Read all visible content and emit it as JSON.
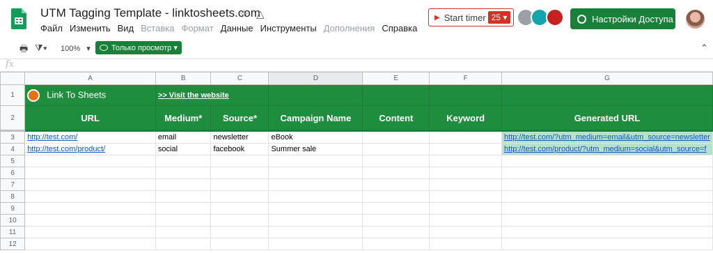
{
  "doc": {
    "title": "UTM Tagging Template - linktosheets.com",
    "menu": [
      {
        "label": "Файл",
        "dim": false
      },
      {
        "label": "Изменить",
        "dim": false
      },
      {
        "label": "Вид",
        "dim": false
      },
      {
        "label": "Вставка",
        "dim": true
      },
      {
        "label": "Формат",
        "dim": true
      },
      {
        "label": "Данные",
        "dim": false
      },
      {
        "label": "Инструменты",
        "dim": false
      },
      {
        "label": "Дополнения",
        "dim": true
      },
      {
        "label": "Справка",
        "dim": false
      }
    ]
  },
  "header": {
    "timer_label": "Start timer",
    "timer_count": "25",
    "share_label": "Настройки Доступа"
  },
  "toolbar": {
    "zoom": "100%",
    "view_only": "Только просмотр",
    "fx": "fx"
  },
  "columns": [
    "A",
    "B",
    "C",
    "D",
    "E",
    "F",
    "G"
  ],
  "banner": {
    "title": "Link To Sheets",
    "link": ">> Visit the website"
  },
  "table": {
    "headers": [
      "URL",
      "Medium*",
      "Source*",
      "Campaign Name",
      "Content",
      "Keyword",
      "Generated URL"
    ],
    "rows": [
      {
        "url": "http://test.com/",
        "medium": "email",
        "source": "newsletter",
        "campaign": "eBook",
        "content": "",
        "keyword": "",
        "generated": "http://test.com/?utm_medium=email&utm_source=newsletter"
      },
      {
        "url": "http://test.com/product/",
        "medium": "social",
        "source": "facebook",
        "campaign": "Summer sale",
        "content": "",
        "keyword": "",
        "generated": "http://test.com/product/?utm_medium=social&utm_source=f"
      }
    ],
    "row_numbers": [
      "1",
      "2",
      "3",
      "4",
      "5",
      "6",
      "7",
      "8",
      "9",
      "10",
      "11",
      "12"
    ]
  },
  "colors": {
    "brand_green": "#188038",
    "timer_red": "#d93025",
    "generated_bg": "#b7e1cd"
  }
}
